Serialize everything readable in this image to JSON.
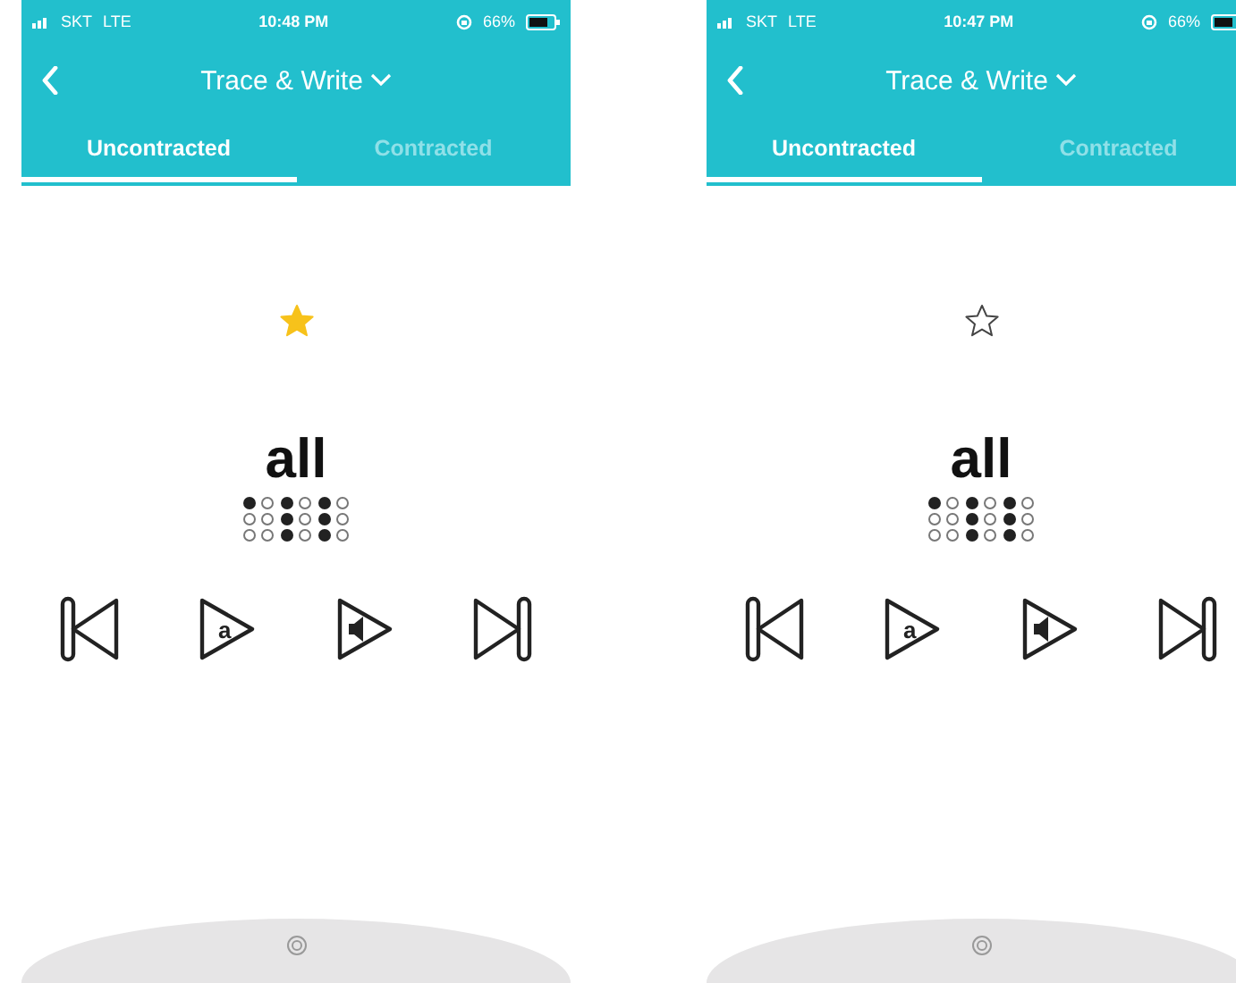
{
  "phones": [
    {
      "status_bar": {
        "carrier": "SKT",
        "network": "LTE",
        "time": "10:48 PM",
        "battery": "66%"
      },
      "nav": {
        "title": "Trace & Write"
      },
      "tabs": [
        {
          "label": "Uncontracted",
          "selected": true
        },
        {
          "label": "Contracted",
          "selected": false
        }
      ],
      "starred": true,
      "word": "all",
      "braille": [
        {
          "dots": [
            {
              "raised": true
            },
            {
              "raised": false
            },
            {
              "raised": false
            },
            {
              "raised": false
            },
            {
              "raised": false
            },
            {
              "raised": false
            }
          ]
        },
        {
          "dots": [
            {
              "raised": true
            },
            {
              "raised": true
            },
            {
              "raised": true
            },
            {
              "raised": false
            },
            {
              "raised": false
            },
            {
              "raised": false
            }
          ]
        },
        {
          "dots": [
            {
              "raised": true
            },
            {
              "raised": true
            },
            {
              "raised": true
            },
            {
              "raised": false
            },
            {
              "raised": false
            },
            {
              "raised": false
            }
          ]
        }
      ],
      "controls": [
        {
          "kind": "previous"
        },
        {
          "kind": "letter",
          "label": "a"
        },
        {
          "kind": "sound"
        },
        {
          "kind": "next"
        }
      ]
    },
    {
      "status_bar": {
        "carrier": "SKT",
        "network": "LTE",
        "time": "10:47 PM",
        "battery": "66%"
      },
      "nav": {
        "title": "Trace & Write"
      },
      "tabs": [
        {
          "label": "Uncontracted",
          "selected": true
        },
        {
          "label": "Contracted",
          "selected": false
        }
      ],
      "starred": false,
      "word": "all",
      "braille": [
        {
          "dots": [
            {
              "raised": true
            },
            {
              "raised": false
            },
            {
              "raised": false
            },
            {
              "raised": false
            },
            {
              "raised": false
            },
            {
              "raised": false
            }
          ]
        },
        {
          "dots": [
            {
              "raised": true
            },
            {
              "raised": true
            },
            {
              "raised": true
            },
            {
              "raised": false
            },
            {
              "raised": false
            },
            {
              "raised": false
            }
          ]
        },
        {
          "dots": [
            {
              "raised": true
            },
            {
              "raised": true
            },
            {
              "raised": true
            },
            {
              "raised": false
            },
            {
              "raised": false
            },
            {
              "raised": false
            }
          ]
        }
      ],
      "controls": [
        {
          "kind": "previous"
        },
        {
          "kind": "letter",
          "label": "a"
        },
        {
          "kind": "sound"
        },
        {
          "kind": "next"
        }
      ]
    }
  ]
}
